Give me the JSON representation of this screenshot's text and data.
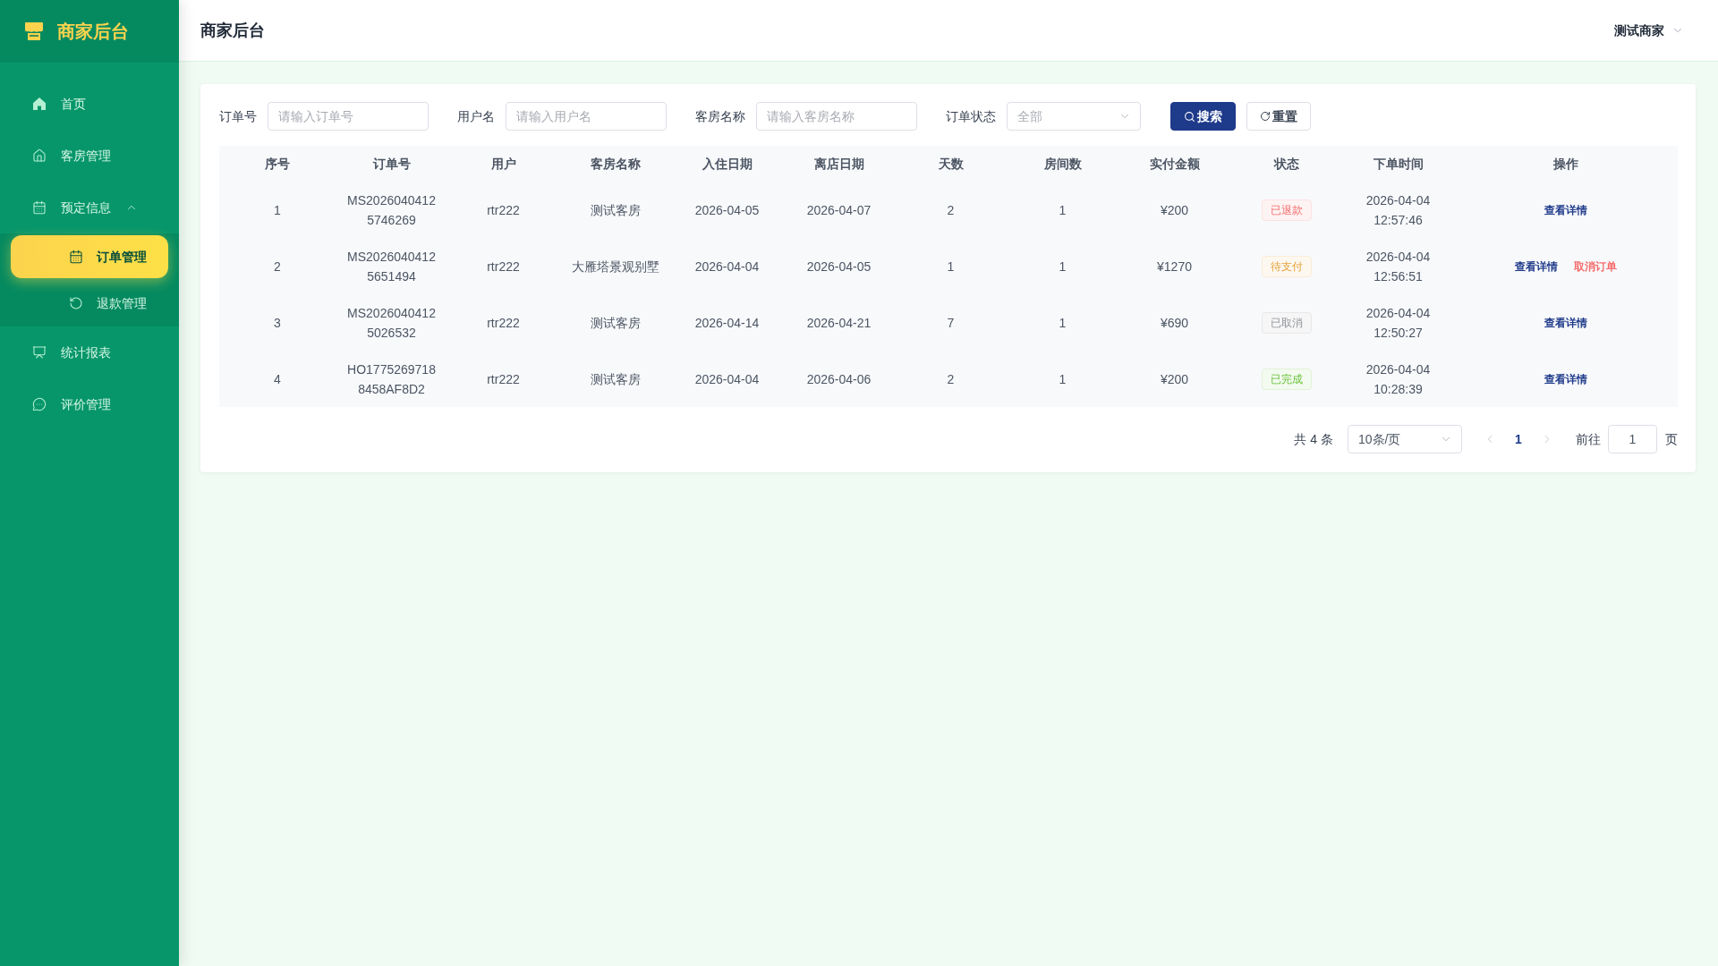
{
  "sidebar": {
    "logo_text": "商家后台",
    "items": [
      {
        "label": "首页",
        "selected": false
      },
      {
        "label": "客房管理",
        "selected": false
      },
      {
        "label": "预定信息",
        "selected": false,
        "expanded": true,
        "children": [
          {
            "label": "订单管理",
            "selected": true
          },
          {
            "label": "退款管理",
            "selected": false
          }
        ]
      },
      {
        "label": "统计报表",
        "selected": false
      },
      {
        "label": "评价管理",
        "selected": false
      }
    ]
  },
  "header": {
    "title": "商家后台",
    "user": "测试商家"
  },
  "filters": [
    {
      "kind": "input",
      "label": "订单号",
      "placeholder": "请输入订单号"
    },
    {
      "kind": "input",
      "label": "用户名",
      "placeholder": "请输入用户名"
    },
    {
      "kind": "input",
      "label": "客房名称",
      "placeholder": "请输入客房名称"
    },
    {
      "kind": "select",
      "label": "订单状态",
      "placeholder": "全部"
    }
  ],
  "buttons": [
    {
      "kind": "search",
      "label": "搜索"
    },
    {
      "kind": "reset",
      "label": "重置"
    }
  ],
  "table": {
    "columns": [
      "序号",
      "订单号",
      "用户",
      "客房名称",
      "入住日期",
      "离店日期",
      "天数",
      "房间数",
      "实付金额",
      "状态",
      "下单时间",
      "操作"
    ],
    "rows": [
      {
        "cells": [
          "1",
          "MS20260404125746269",
          "rtr222",
          "测试客房",
          "2026-04-05",
          "2026-04-07",
          "2",
          "1",
          "¥200"
        ],
        "status": {
          "text": "已退款",
          "color": "#f56c6c"
        },
        "order_time": "2026-04-04 12:57:46",
        "actions": [
          {
            "kind": "view",
            "label": "查看详情"
          }
        ]
      },
      {
        "cells": [
          "2",
          "MS20260404125651494",
          "rtr222",
          "大雁塔景观别墅",
          "2026-04-04",
          "2026-04-05",
          "1",
          "1",
          "¥1270"
        ],
        "status": {
          "text": "待支付",
          "color": "#e6a23c"
        },
        "order_time": "2026-04-04 12:56:51",
        "actions": [
          {
            "kind": "view",
            "label": "查看详情"
          },
          {
            "kind": "cancel",
            "label": "取消订单"
          }
        ]
      },
      {
        "cells": [
          "3",
          "MS20260404125026532",
          "rtr222",
          "测试客房",
          "2026-04-14",
          "2026-04-21",
          "7",
          "1",
          "¥690"
        ],
        "status": {
          "text": "已取消",
          "color": "#909399"
        },
        "order_time": "2026-04-04 12:50:27",
        "actions": [
          {
            "kind": "view",
            "label": "查看详情"
          }
        ]
      },
      {
        "cells": [
          "4",
          "HO17752697188458AF8D2",
          "rtr222",
          "测试客房",
          "2026-04-04",
          "2026-04-06",
          "2",
          "1",
          "¥200"
        ],
        "status": {
          "text": "已完成",
          "color": "#67c23a"
        },
        "order_time": "2026-04-04 10:28:39",
        "actions": [
          {
            "kind": "view",
            "label": "查看详情"
          }
        ]
      }
    ]
  },
  "pagination": {
    "total": "共 4 条",
    "page_size": "10条/页",
    "prev_disabled": true,
    "pages": [
      {
        "label": "1",
        "selected": true
      }
    ],
    "next_disabled": true,
    "goto_label": "前往",
    "goto_value": "1",
    "goto_suffix": "页"
  }
}
